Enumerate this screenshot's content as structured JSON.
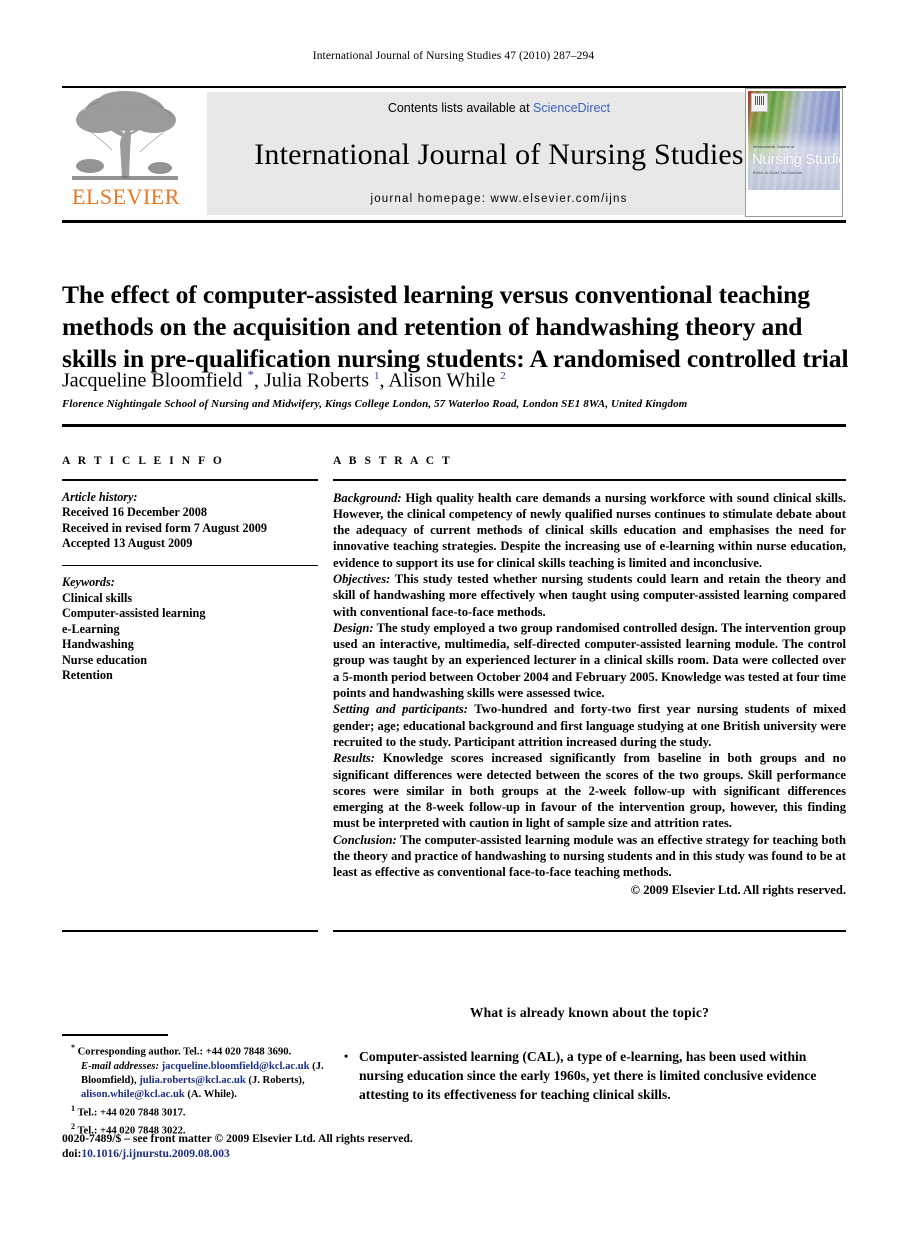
{
  "running_head": "International Journal of Nursing Studies 47 (2010) 287–294",
  "masthead": {
    "contents_prefix": "Contents lists available at ",
    "sciencedirect": "ScienceDirect",
    "journal_title": "International Journal of Nursing Studies",
    "homepage": "journal homepage: www.elsevier.com/ijns",
    "publisher": "ELSEVIER",
    "publisher_color": "#e87722",
    "link_color": "#3a62c6",
    "cover": {
      "small_label": "International Journal of",
      "title": "Nursing Studies",
      "editors": "Editor-in-Chief:  Ian Norman"
    }
  },
  "article": {
    "title": "The effect of computer-assisted learning versus conventional teaching methods on the acquisition and retention of handwashing theory and skills in pre-qualification nursing students: A randomised controlled trial",
    "authors_html": "Jacqueline Bloomfield <span class=\"star\">*</span>, Julia Roberts <sup>1</sup>, Alison While <sup>2</sup>",
    "affiliation": "Florence Nightingale School of Nursing and Midwifery, Kings College London, 57 Waterloo Road, London SE1 8WA, United Kingdom"
  },
  "article_info": {
    "heading": "A R T I C L E  I N F O",
    "history_label": "Article history:",
    "history": [
      "Received 16 December 2008",
      "Received in revised form 7 August 2009",
      "Accepted 13 August 2009"
    ],
    "keywords_label": "Keywords:",
    "keywords": [
      "Clinical skills",
      "Computer-assisted learning",
      "e-Learning",
      "Handwashing",
      "Nurse education",
      "Retention"
    ]
  },
  "abstract": {
    "heading": "A B S T R A C T",
    "sections": [
      {
        "label": "Background:",
        "text": " High quality health care demands a nursing workforce with sound clinical skills. However, the clinical competency of newly qualified nurses continues to stimulate debate about the adequacy of current methods of clinical skills education and emphasises the need for innovative teaching strategies. Despite the increasing use of e-learning within nurse education, evidence to support its use for clinical skills teaching is limited and inconclusive."
      },
      {
        "label": "Objectives:",
        "text": " This study tested whether nursing students could learn and retain the theory and skill of handwashing more effectively when taught using computer-assisted learning compared with conventional face-to-face methods."
      },
      {
        "label": "Design:",
        "text": " The study employed a two group randomised controlled design. The intervention group used an interactive, multimedia, self-directed computer-assisted learning module. The control group was taught by an experienced lecturer in a clinical skills room. Data were collected over a 5-month period between October 2004 and February 2005. Knowledge was tested at four time points and handwashing skills were assessed twice."
      },
      {
        "label": "Setting and participants:",
        "text": " Two-hundred and forty-two first year nursing students of mixed gender; age; educational background and first language studying at one British university were recruited to the study. Participant attrition increased during the study."
      },
      {
        "label": "Results:",
        "text": " Knowledge scores increased significantly from baseline in both groups and no significant differences were detected between the scores of the two groups. Skill performance scores were similar in both groups at the 2-week follow-up with significant differences emerging at the 8-week follow-up in favour of the intervention group, however, this finding must be interpreted with caution in light of sample size and attrition rates."
      },
      {
        "label": "Conclusion:",
        "text": " The computer-assisted learning module was an effective strategy for teaching both the theory and practice of handwashing to nursing students and in this study was found to be at least as effective as conventional face-to-face teaching methods."
      }
    ],
    "copyright": "© 2009 Elsevier Ltd. All rights reserved."
  },
  "footnotes": {
    "corresponding": "Corresponding author. Tel.: +44 020 7848 3690.",
    "email_label": "E-mail addresses:",
    "emails": [
      {
        "address": "jacqueline.bloomfield@kcl.ac.uk",
        "name": "(J. Bloomfield),"
      },
      {
        "address": "julia.roberts@kcl.ac.uk",
        "name": "(J. Roberts),"
      },
      {
        "address": "alison.while@kcl.ac.uk",
        "name": "(A. While)."
      }
    ],
    "tel1": "Tel.: +44 020 7848 3017.",
    "tel2": "Tel.: +44 020 7848 3022."
  },
  "issn_line": {
    "text": "0020-7489/$ – see front matter © 2009 Elsevier Ltd. All rights reserved.",
    "doi_prefix": "doi:",
    "doi": "10.1016/j.ijnurstu.2009.08.003"
  },
  "key_points": {
    "heading": "What is already known about the topic?",
    "items": [
      "Computer-assisted learning (CAL), a type of e-learning, has been used within nursing education since the early 1960s, yet there is limited conclusive evidence attesting to its effectiveness for teaching clinical skills."
    ]
  }
}
